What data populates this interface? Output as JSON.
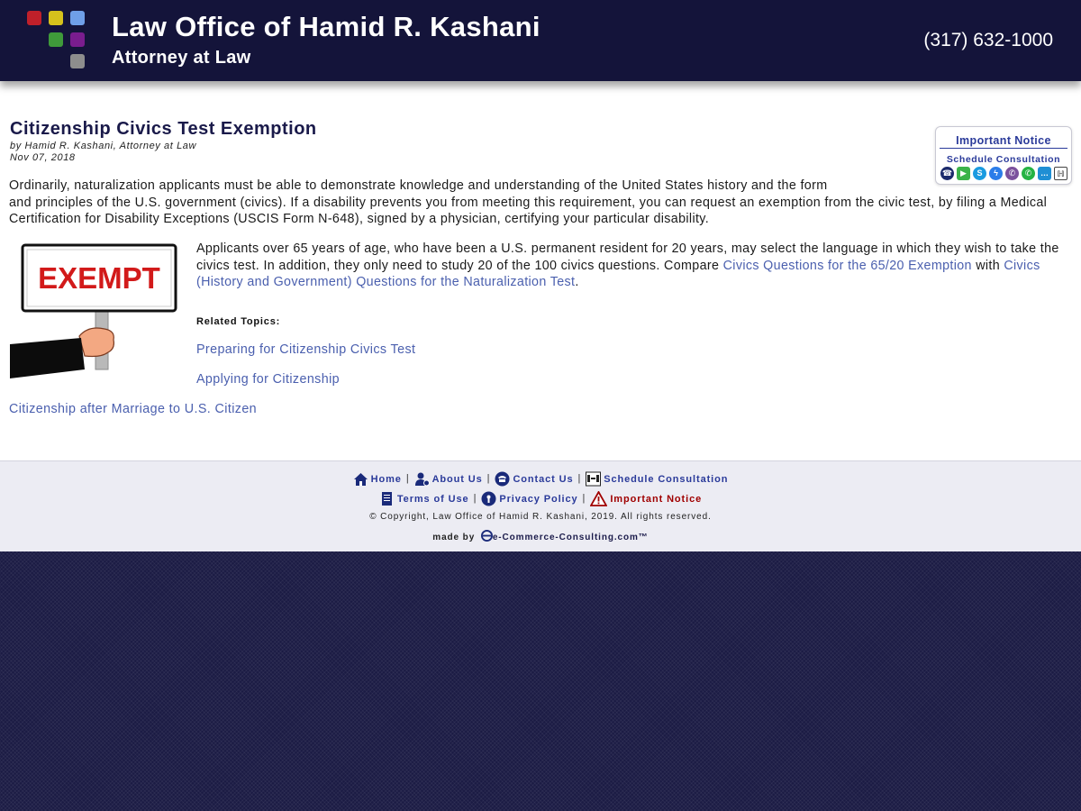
{
  "header": {
    "title": "Law Office of Hamid R. Kashani",
    "subtitle": "Attorney at Law",
    "phone": "(317) 632-1000",
    "logo_colors": [
      "#c0202a",
      "#d6c21c",
      "#6f9fe8",
      "#3f9a3a",
      "#7a1d8e",
      "#8d8d8d"
    ]
  },
  "sidebar_box": {
    "notice_label": "Important Notice",
    "consult_label": "Schedule Consultation",
    "contact_icons": [
      "phone-icon",
      "video-call-icon",
      "skype-icon",
      "messenger-icon",
      "viber-icon",
      "whatsapp-icon",
      "chat-icon",
      "consultation-icon"
    ]
  },
  "article": {
    "title": "Citizenship Civics Test Exemption",
    "byline": "by Hamid R. Kashani, Attorney at Law",
    "date": "Nov 07, 2018",
    "paragraph1_line1": "Ordinarily, naturalization applicants must be able to demonstrate knowledge and understanding of the United States history and the form",
    "paragraph1_line2": "and principles of the U.S. government (civics).  If a disability prevents you from meeting this requirement, you can request an exemption from the civic test, by filing a Medical Certification for Disability Exceptions (USCIS Form N-648), signed by a physician, certifying your particular disability.",
    "image_sign_text": "EXEMPT",
    "paragraph2_text": "Applicants over 65 years of age, who have been a U.S. permanent resident for 20 years, may select the language in which they wish to take the civics test. In addition, they only need to study 20 of the 100 civics questions. Compare ",
    "paragraph2_link1": "Civics Questions for the 65/20 Exemption",
    "paragraph2_mid": " with ",
    "paragraph2_link2": "Civics (History and Government) Questions for the Naturalization Test",
    "paragraph2_end": ".",
    "related_label": "Related Topics:",
    "related_links": [
      "Preparing for Citizenship Civics Test",
      "Applying for Citizenship",
      "Citizenship after Marriage to U.S. Citizen"
    ]
  },
  "footer": {
    "links_row1": [
      "Home",
      "About Us",
      "Contact Us",
      "Schedule Consultation"
    ],
    "links_row2": [
      "Terms of Use",
      "Privacy Policy",
      "Important Notice"
    ],
    "separator": "|",
    "copyright": "© Copyright, Law Office of Hamid R. Kashani, 2019. All rights reserved.",
    "made_by_prefix": "made by",
    "made_by_company": "e-Commerce-Consulting.com™"
  },
  "colors": {
    "header_bg": "#14143a",
    "link": "#4a5fae",
    "footer_link": "#2a3a9a",
    "alert": "#a00000"
  }
}
